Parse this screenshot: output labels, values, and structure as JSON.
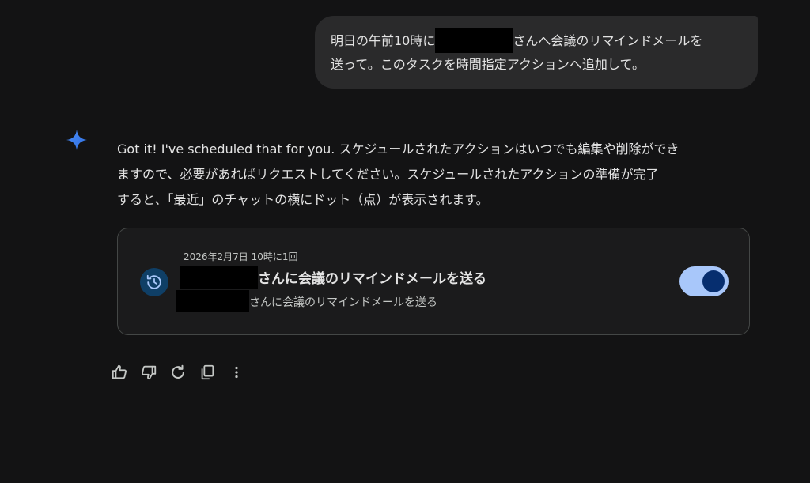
{
  "user_message": {
    "line1_before": "明日の午前10時に",
    "line1_after": "さんへ会議のリマインドメールを",
    "line2": "送って。このタスクを時間指定アクションへ追加して。"
  },
  "assistant": {
    "icon": "gemini-sparkle-icon",
    "reply_lines": [
      "Got it! I've scheduled that for you. スケジュールされたアクションはいつでも編集や削除ができ",
      "ますので、必要があればリクエストしてください。スケジュールされたアクションの準備が完了",
      "すると、「最近」のチャットの横にドット（点）が表示されます。"
    ]
  },
  "scheduled_action": {
    "schedule": "2026年2月7日 10時に1回",
    "title_suffix": "さんに会議のリマインドメールを送る",
    "subtitle_suffix": "さんに会議のリマインドメールを送る",
    "enabled": true,
    "icon": "schedule-history-icon"
  },
  "colors": {
    "background": "#131314",
    "bubble": "#2a2a2b",
    "accent": "#a8c7fa",
    "sparkle": "#4a8cf7"
  },
  "action_icons": [
    "thumbs-up-icon",
    "thumbs-down-icon",
    "redo-icon",
    "copy-icon",
    "more-vert-icon"
  ]
}
